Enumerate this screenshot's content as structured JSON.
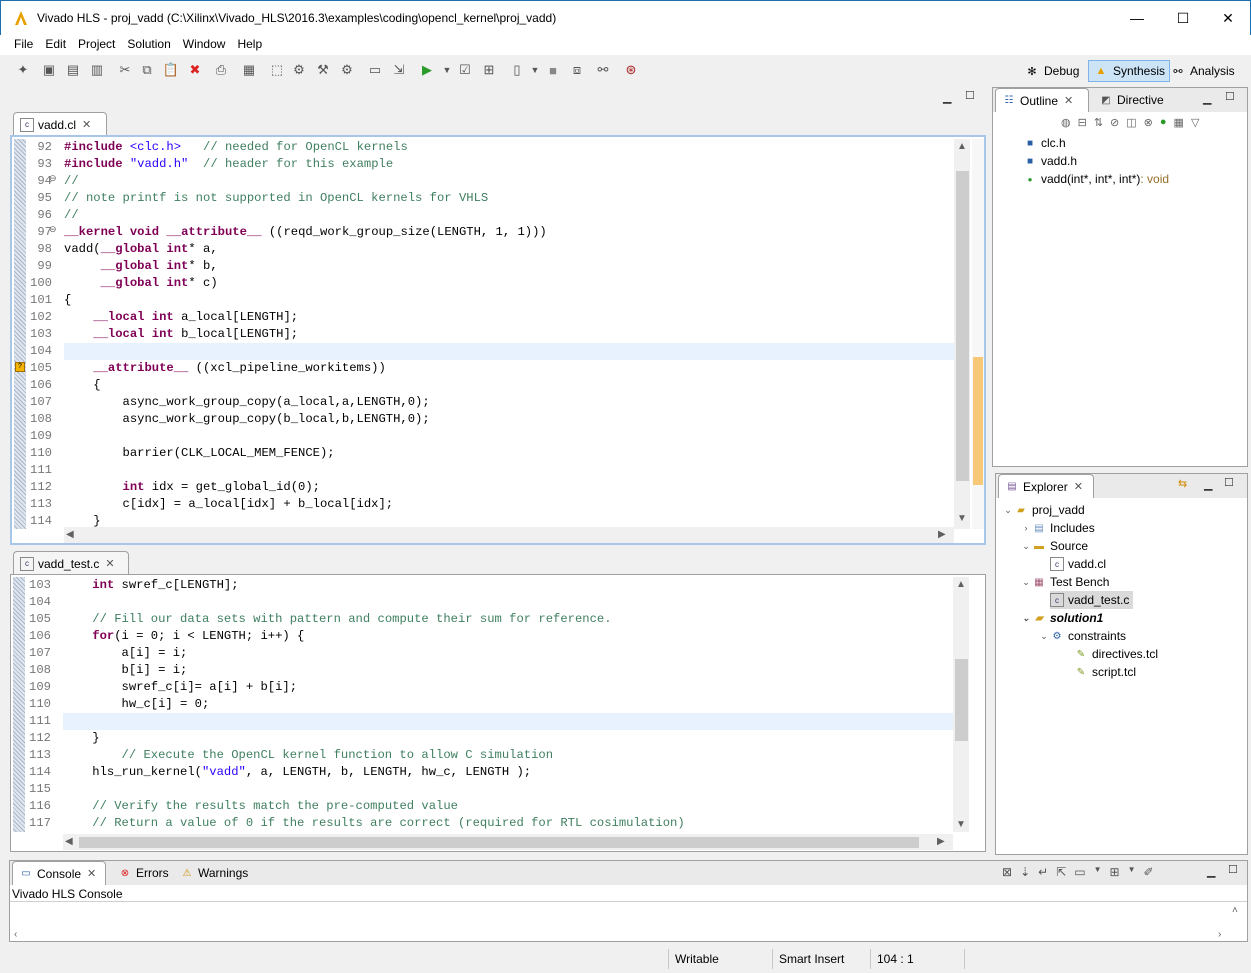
{
  "window": {
    "title": "Vivado HLS - proj_vadd (C:\\Xilinx\\Vivado_HLS\\2016.3\\examples\\coding\\opencl_kernel\\proj_vadd)",
    "minimize": "—",
    "maximize": "☐",
    "close": "✕"
  },
  "menu": [
    "File",
    "Edit",
    "Project",
    "Solution",
    "Window",
    "Help"
  ],
  "perspectives": {
    "debug": "Debug",
    "synthesis": "Synthesis",
    "analysis": "Analysis"
  },
  "editor1": {
    "tab": "vadd.cl",
    "lines": [
      {
        "n": "92",
        "t": "#include <clc.h>   // needed for OpenCL kernels"
      },
      {
        "n": "93",
        "t": "#include \"vadd.h\"  // header for this example"
      },
      {
        "n": "94",
        "t": "//"
      },
      {
        "n": "95",
        "t": "// note printf is not supported in OpenCL kernels for VHLS"
      },
      {
        "n": "96",
        "t": "//"
      },
      {
        "n": "97",
        "t": "__kernel void __attribute__ ((reqd_work_group_size(LENGTH, 1, 1)))"
      },
      {
        "n": "98",
        "t": "vadd(__global int* a,"
      },
      {
        "n": "99",
        "t": "     __global int* b,"
      },
      {
        "n": "100",
        "t": "     __global int* c)"
      },
      {
        "n": "101",
        "t": "{"
      },
      {
        "n": "102",
        "t": "    __local int a_local[LENGTH];"
      },
      {
        "n": "103",
        "t": "    __local int b_local[LENGTH];"
      },
      {
        "n": "104",
        "t": ""
      },
      {
        "n": "105",
        "t": "    __attribute__ ((xcl_pipeline_workitems))"
      },
      {
        "n": "106",
        "t": "    {"
      },
      {
        "n": "107",
        "t": "        async_work_group_copy(a_local,a,LENGTH,0);"
      },
      {
        "n": "108",
        "t": "        async_work_group_copy(b_local,b,LENGTH,0);"
      },
      {
        "n": "109",
        "t": ""
      },
      {
        "n": "110",
        "t": "        barrier(CLK_LOCAL_MEM_FENCE);"
      },
      {
        "n": "111",
        "t": ""
      },
      {
        "n": "112",
        "t": "        int idx = get_global_id(0);"
      },
      {
        "n": "113",
        "t": "        c[idx] = a_local[idx] + b_local[idx];"
      },
      {
        "n": "114",
        "t": "    }"
      }
    ]
  },
  "editor2": {
    "tab": "vadd_test.c",
    "lines": [
      {
        "n": "103",
        "t": "    int swref_c[LENGTH];"
      },
      {
        "n": "104",
        "t": ""
      },
      {
        "n": "105",
        "t": "    // Fill our data sets with pattern and compute their sum for reference."
      },
      {
        "n": "106",
        "t": "    for(i = 0; i < LENGTH; i++) {"
      },
      {
        "n": "107",
        "t": "        a[i] = i;"
      },
      {
        "n": "108",
        "t": "        b[i] = i;"
      },
      {
        "n": "109",
        "t": "        swref_c[i]= a[i] + b[i];"
      },
      {
        "n": "110",
        "t": "        hw_c[i] = 0;"
      },
      {
        "n": "111",
        "t": ""
      },
      {
        "n": "112",
        "t": "    }"
      },
      {
        "n": "113",
        "t": "        // Execute the OpenCL kernel function to allow C simulation"
      },
      {
        "n": "114",
        "t": "    hls_run_kernel(\"vadd\", a, LENGTH, b, LENGTH, hw_c, LENGTH );"
      },
      {
        "n": "115",
        "t": ""
      },
      {
        "n": "116",
        "t": "    // Verify the results match the pre-computed value"
      },
      {
        "n": "117",
        "t": "    // Return a value of 0 if the results are correct (required for RTL cosimulation)"
      }
    ]
  },
  "outline": {
    "tab": "Outline",
    "tab2": "Directive",
    "items": [
      {
        "label": "clc.h",
        "suffix": ""
      },
      {
        "label": "vadd.h",
        "suffix": ""
      },
      {
        "label": "vadd(int*, int*, int*)",
        "suffix": " : void"
      }
    ]
  },
  "explorer": {
    "tab": "Explorer",
    "items": [
      {
        "label": "proj_vadd"
      },
      {
        "label": "Includes"
      },
      {
        "label": "Source"
      },
      {
        "label": "vadd.cl"
      },
      {
        "label": "Test Bench"
      },
      {
        "label": "vadd_test.c"
      },
      {
        "label": "solution1"
      },
      {
        "label": "constraints"
      },
      {
        "label": "directives.tcl"
      },
      {
        "label": "script.tcl"
      }
    ]
  },
  "console": {
    "tabs": [
      "Console",
      "Errors",
      "Warnings"
    ],
    "title": "Vivado HLS Console"
  },
  "status": {
    "writable": "Writable",
    "insert": "Smart Insert",
    "position": "104 : 1"
  },
  "colors": {
    "keyword": "#7f0055",
    "string": "#2a00ff",
    "comment": "#3f7f5f",
    "current_line": "#e8f2fe",
    "selection": "#dadada"
  }
}
